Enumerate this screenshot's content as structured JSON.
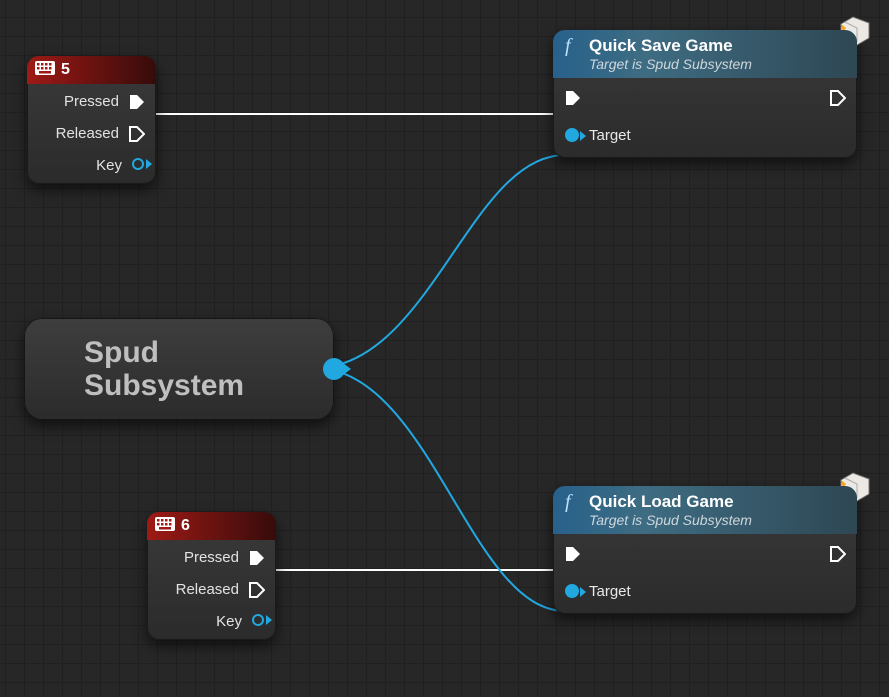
{
  "nodes": {
    "key5": {
      "title": "5",
      "pins": {
        "pressed": "Pressed",
        "released": "Released",
        "key": "Key"
      }
    },
    "key6": {
      "title": "6",
      "pins": {
        "pressed": "Pressed",
        "released": "Released",
        "key": "Key"
      }
    },
    "subsystem": {
      "title": "Spud Subsystem"
    },
    "quickSave": {
      "title": "Quick Save Game",
      "subtitle": "Target is Spud Subsystem",
      "targetLabel": "Target"
    },
    "quickLoad": {
      "title": "Quick Load Game",
      "subtitle": "Target is Spud Subsystem",
      "targetLabel": "Target"
    }
  },
  "colors": {
    "exec": "#ffffff",
    "object": "#22a8e0",
    "eventHeader": "#9f1a16",
    "funcHeader": "#2f6e94"
  }
}
